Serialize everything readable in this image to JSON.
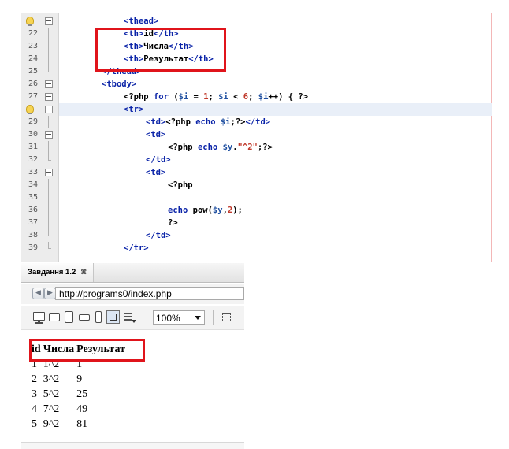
{
  "editor": {
    "lines": [
      {
        "num": "",
        "marker": "bulb",
        "fold": "open",
        "indent": 4,
        "tokens": [
          {
            "c": "tag",
            "t": "<thead>"
          }
        ]
      },
      {
        "num": "22",
        "marker": "",
        "fold": "line",
        "indent": 4,
        "tokens": [
          {
            "c": "tag",
            "t": "<th>"
          },
          {
            "c": "ph",
            "t": "id"
          },
          {
            "c": "tag",
            "t": "</th>"
          }
        ]
      },
      {
        "num": "23",
        "marker": "",
        "fold": "line",
        "indent": 4,
        "tokens": [
          {
            "c": "tag",
            "t": "<th>"
          },
          {
            "c": "ph",
            "t": "Числа"
          },
          {
            "c": "tag",
            "t": "</th>"
          }
        ]
      },
      {
        "num": "24",
        "marker": "",
        "fold": "line",
        "indent": 4,
        "tokens": [
          {
            "c": "tag",
            "t": "<th>"
          },
          {
            "c": "ph",
            "t": "Результат"
          },
          {
            "c": "tag",
            "t": "</th>"
          }
        ]
      },
      {
        "num": "25",
        "marker": "",
        "fold": "end",
        "indent": 3,
        "tokens": [
          {
            "c": "tag",
            "t": "</thead>"
          }
        ]
      },
      {
        "num": "26",
        "marker": "",
        "fold": "open",
        "indent": 3,
        "tokens": [
          {
            "c": "tag",
            "t": "<tbody>"
          }
        ]
      },
      {
        "num": "27",
        "marker": "",
        "fold": "open",
        "indent": 4,
        "tokens": [
          {
            "c": "ph",
            "t": "<?php "
          },
          {
            "c": "kw",
            "t": "for"
          },
          {
            "c": "ph",
            "t": " ("
          },
          {
            "c": "var",
            "t": "$i"
          },
          {
            "c": "ph",
            "t": " = "
          },
          {
            "c": "num",
            "t": "1"
          },
          {
            "c": "ph",
            "t": "; "
          },
          {
            "c": "var",
            "t": "$i"
          },
          {
            "c": "ph",
            "t": " < "
          },
          {
            "c": "num",
            "t": "6"
          },
          {
            "c": "ph",
            "t": "; "
          },
          {
            "c": "var",
            "t": "$i"
          },
          {
            "c": "ph",
            "t": "++) { ?>"
          }
        ]
      },
      {
        "num": "",
        "marker": "bulb",
        "fold": "open",
        "indent": 4,
        "hl": true,
        "tokens": [
          {
            "c": "tag",
            "t": "<tr>"
          }
        ]
      },
      {
        "num": "29",
        "marker": "",
        "fold": "line",
        "indent": 5,
        "tokens": [
          {
            "c": "tag",
            "t": "<td>"
          },
          {
            "c": "ph",
            "t": "<?php "
          },
          {
            "c": "kw",
            "t": "echo"
          },
          {
            "c": "ph",
            "t": " "
          },
          {
            "c": "var",
            "t": "$i"
          },
          {
            "c": "ph",
            "t": ";?>"
          },
          {
            "c": "tag",
            "t": "</td>"
          }
        ]
      },
      {
        "num": "30",
        "marker": "",
        "fold": "open",
        "indent": 5,
        "tokens": [
          {
            "c": "tag",
            "t": "<td>"
          }
        ]
      },
      {
        "num": "31",
        "marker": "",
        "fold": "line",
        "indent": 6,
        "tokens": [
          {
            "c": "ph",
            "t": "<?php "
          },
          {
            "c": "kw",
            "t": "echo"
          },
          {
            "c": "ph",
            "t": " "
          },
          {
            "c": "var",
            "t": "$y"
          },
          {
            "c": "ph",
            "t": "."
          },
          {
            "c": "str",
            "t": "\"^2\""
          },
          {
            "c": "ph",
            "t": ";?>"
          }
        ]
      },
      {
        "num": "32",
        "marker": "",
        "fold": "end",
        "indent": 5,
        "tokens": [
          {
            "c": "tag",
            "t": "</td>"
          }
        ]
      },
      {
        "num": "33",
        "marker": "",
        "fold": "open",
        "indent": 5,
        "tokens": [
          {
            "c": "tag",
            "t": "<td>"
          }
        ]
      },
      {
        "num": "34",
        "marker": "",
        "fold": "line",
        "indent": 6,
        "tokens": [
          {
            "c": "ph",
            "t": "<?php"
          }
        ]
      },
      {
        "num": "35",
        "marker": "",
        "fold": "line",
        "indent": 6,
        "tokens": []
      },
      {
        "num": "36",
        "marker": "",
        "fold": "line",
        "indent": 6,
        "tokens": [
          {
            "c": "kw",
            "t": "echo"
          },
          {
            "c": "ph",
            "t": " pow("
          },
          {
            "c": "var",
            "t": "$y"
          },
          {
            "c": "ph",
            "t": ","
          },
          {
            "c": "num",
            "t": "2"
          },
          {
            "c": "ph",
            "t": ");"
          }
        ]
      },
      {
        "num": "37",
        "marker": "",
        "fold": "line",
        "indent": 6,
        "tokens": [
          {
            "c": "ph",
            "t": "?>"
          }
        ]
      },
      {
        "num": "38",
        "marker": "",
        "fold": "end",
        "indent": 5,
        "tokens": [
          {
            "c": "tag",
            "t": "</td>"
          }
        ]
      },
      {
        "num": "39",
        "marker": "",
        "fold": "end",
        "indent": 4,
        "tokens": [
          {
            "c": "tag",
            "t": "</tr>"
          }
        ]
      }
    ]
  },
  "browser": {
    "tab_label": "Завдання 1.2",
    "tab_close": "⌘",
    "back_icon": "arrow-left-icon",
    "forward_icon": "arrow-right-icon",
    "url": "http://programs0/index.php",
    "zoom": "100%",
    "table": {
      "headers": [
        "id",
        "Числа",
        "Результат"
      ],
      "rows": [
        [
          "1",
          "1^2",
          "1"
        ],
        [
          "2",
          "3^2",
          "9"
        ],
        [
          "3",
          "5^2",
          "25"
        ],
        [
          "4",
          "7^2",
          "49"
        ],
        [
          "5",
          "9^2",
          "81"
        ]
      ]
    }
  },
  "colors": {
    "highlight_box": "#e0141b",
    "tag": "#0b24a8",
    "number": "#c0392b"
  }
}
